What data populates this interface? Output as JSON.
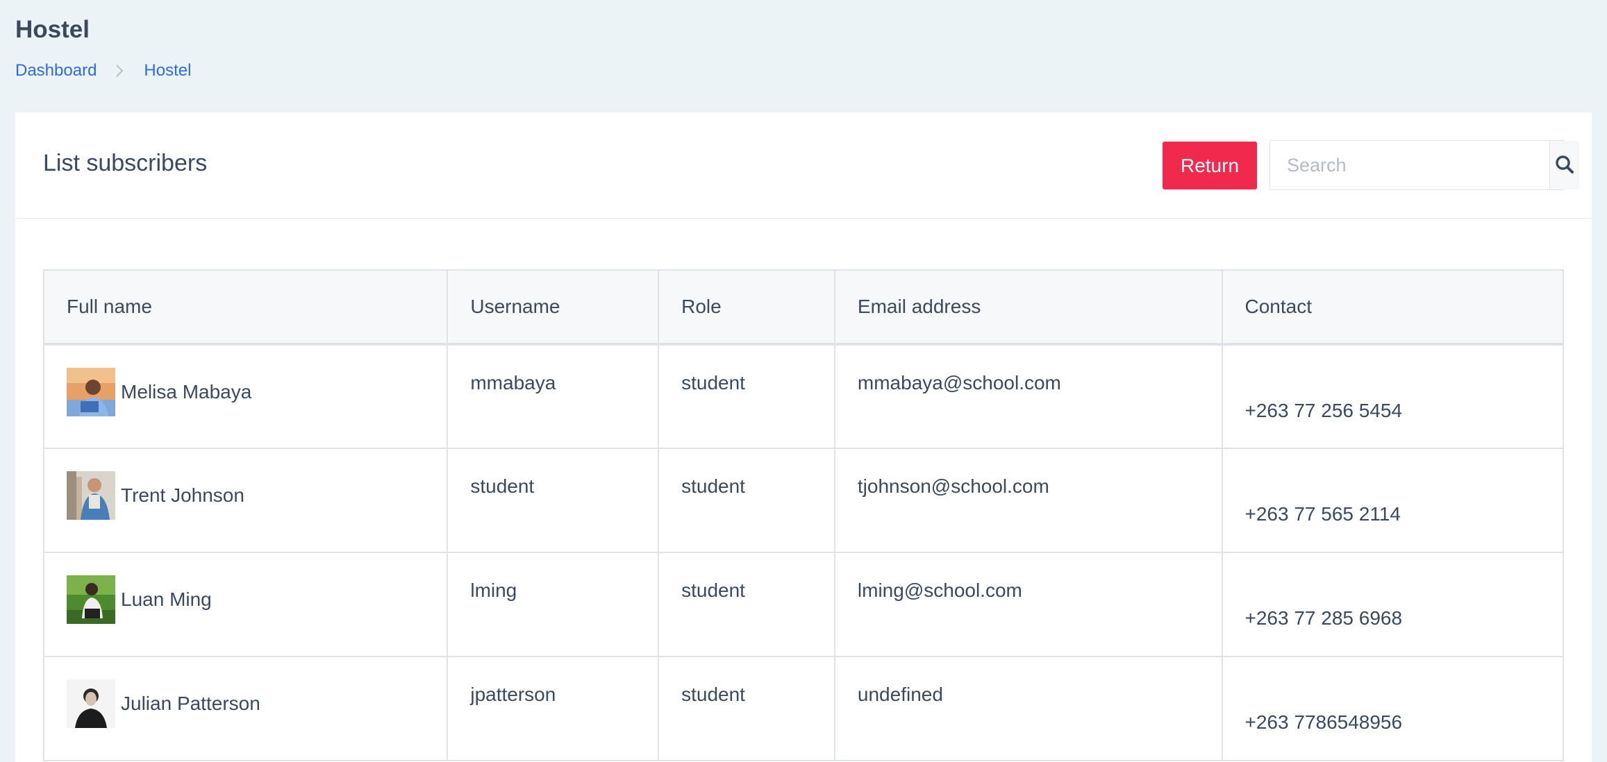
{
  "header": {
    "title": "Hostel",
    "breadcrumb": [
      "Dashboard",
      "Hostel"
    ]
  },
  "card": {
    "title": "List subscribers",
    "return_label": "Return",
    "search_placeholder": "Search"
  },
  "table": {
    "columns": [
      "Full name",
      "Username",
      "Role",
      "Email address",
      "Contact"
    ],
    "rows": [
      {
        "name": "Melisa Mabaya",
        "username": "mmabaya",
        "role": "student",
        "email": "mmabaya@school.com",
        "contact": "+263 77 256 5454"
      },
      {
        "name": "Trent Johnson",
        "username": "student",
        "role": "student",
        "email": "tjohnson@school.com",
        "contact": "+263 77 565 2114"
      },
      {
        "name": "Luan Ming",
        "username": "lming",
        "role": "student",
        "email": "lming@school.com",
        "contact": "+263 77 285 6968"
      },
      {
        "name": "Julian Patterson",
        "username": "jpatterson",
        "role": "student",
        "email": "undefined",
        "contact": "+263 7786548956"
      }
    ]
  },
  "colors": {
    "background": "#ebf3f7",
    "accent_link": "#2d6be0",
    "return_button": "#f0294d"
  },
  "icons": {
    "breadcrumb_separator": "chevron-right-icon",
    "search_button": "search-icon"
  }
}
